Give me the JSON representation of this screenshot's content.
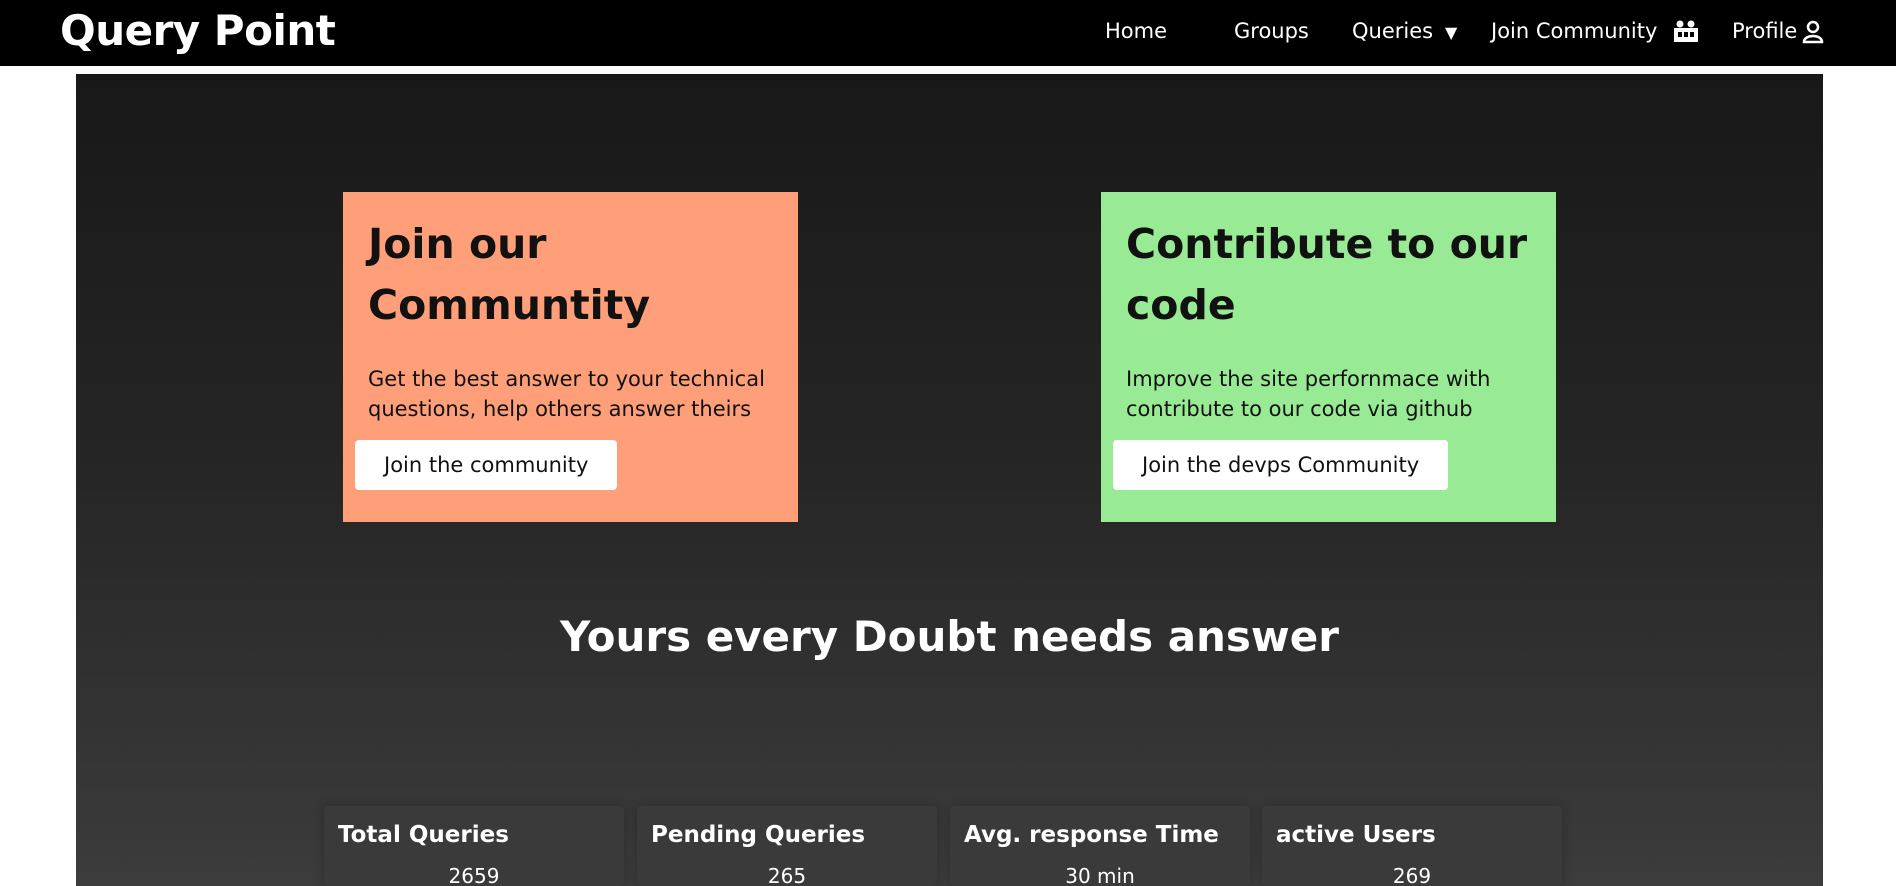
{
  "navbar": {
    "brand": "Query Point",
    "links": {
      "home": "Home",
      "groups": "Groups",
      "queries": "Queries",
      "join_community": "Join Community",
      "profile": "Profile"
    },
    "icons": {
      "queries_caret": "caret-down-icon",
      "join_community": "community-icon",
      "profile": "user-icon"
    }
  },
  "cards": {
    "community": {
      "title_line1": "Join our",
      "title_line2": "Communtity",
      "text_line1": "Get the best answer to your technical",
      "text_line2": "questions, help others answer theirs",
      "button": "Join the community",
      "color": "#ff9f7a"
    },
    "code": {
      "title_line1": "Contribute to our",
      "title_line2": "code",
      "text_line1": "Improve the site perfornmace with",
      "text_line2": "contribute to our code via github",
      "button": "Join the devps Community",
      "color": "#98eb94"
    }
  },
  "headline": "Yours every Doubt needs answer",
  "stats": [
    {
      "label": "Total Queries",
      "value": "2659"
    },
    {
      "label": "Pending Queries",
      "value": "265"
    },
    {
      "label": "Avg. response Time",
      "value": "30 min"
    },
    {
      "label": "active Users",
      "value": "269"
    }
  ]
}
